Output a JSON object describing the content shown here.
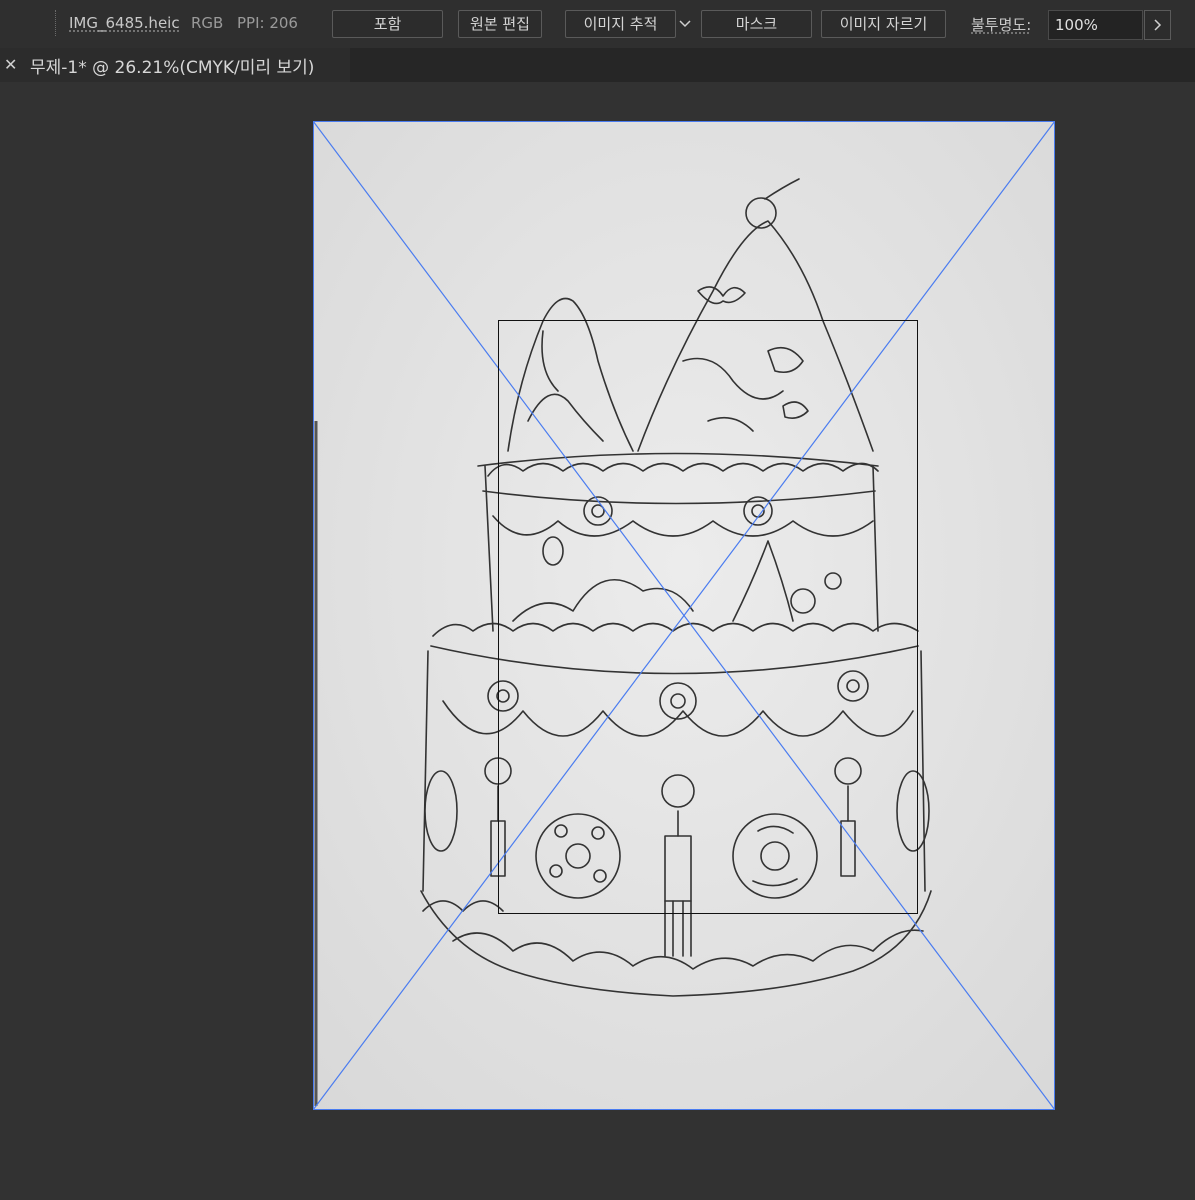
{
  "control_bar": {
    "filename": "IMG_6485.heic",
    "color_mode": "RGB",
    "ppi": "PPI: 206",
    "embed_label": "포함",
    "edit_original_label": "원본 편집",
    "image_trace_label": "이미지 추적",
    "mask_label": "마스크",
    "crop_image_label": "이미지 자르기",
    "opacity_label": "불투명도:",
    "opacity_value": "100%"
  },
  "document_tab": {
    "title": "무제-1* @ 26.21%(CMYK/미리 보기)",
    "close_icon": "close-icon"
  },
  "icons": {
    "dropdown": "chevron-down-icon",
    "opacity_arrow": "chevron-right-icon"
  },
  "colors": {
    "frame_accent": "#4a7cf0",
    "crop_border": "#111111",
    "canvas_bg": "#323232",
    "artboard_bg": "#e8e8e8"
  }
}
